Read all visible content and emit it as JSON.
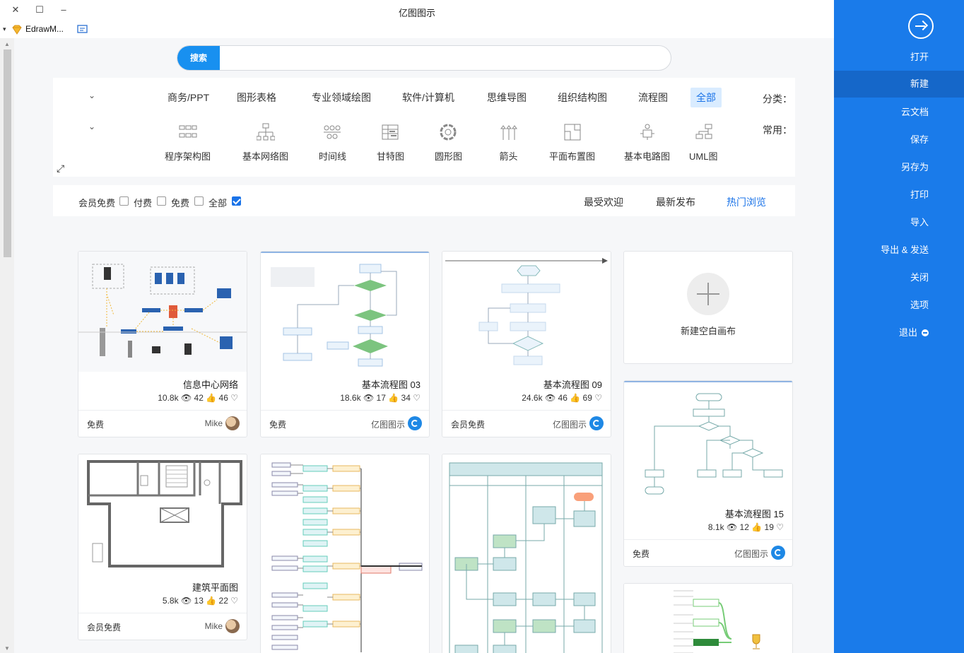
{
  "window": {
    "title": "亿图图示",
    "close": "✕",
    "maximize": "☐",
    "minimize": "–",
    "app_name": "EdrawM...",
    "dropdown": "▾"
  },
  "search": {
    "button": "搜索",
    "placeholder": ""
  },
  "categories": {
    "label": "分类：",
    "items": [
      "全部",
      "流程图",
      "组织结构图",
      "思维导图",
      "软件/计算机",
      "专业领域绘图",
      "图形表格",
      "商务/PPT"
    ],
    "active_index": 0,
    "expand": "⌄"
  },
  "common": {
    "label": "常用：",
    "items": [
      "UML图",
      "基本电路图",
      "平面布置图",
      "箭头",
      "圆形图",
      "甘特图",
      "时间线",
      "基本网络图",
      "程序架构图"
    ],
    "expand": "⌄"
  },
  "expand_icon": "⤢",
  "filter": {
    "tabs": [
      "热门浏览",
      "最新发布",
      "最受欢迎"
    ],
    "active_tab": 0,
    "checks": [
      {
        "label": "全部",
        "checked": true
      },
      {
        "label": "免费",
        "checked": false
      },
      {
        "label": "付费",
        "checked": false
      },
      {
        "label": "会员免费",
        "checked": false
      }
    ]
  },
  "new_blank": {
    "label": "新建空白画布"
  },
  "cards": [
    {
      "title": "基本流程图 09",
      "views": "24.6k",
      "likes": "46",
      "favs": "69",
      "author": "亿图图示",
      "price": "会员免费"
    },
    {
      "title": "基本流程图 03",
      "views": "18.6k",
      "likes": "17",
      "favs": "34",
      "author": "亿图图示",
      "price": "免费"
    },
    {
      "title": "信息中心网络",
      "views": "10.8k",
      "likes": "42",
      "favs": "46",
      "author": "Mike",
      "price": "免费"
    },
    {
      "title": "基本流程图 15",
      "views": "8.1k",
      "likes": "12",
      "favs": "19",
      "author": "亿图图示",
      "price": "免费"
    },
    {
      "title": "建筑平面图",
      "views": "5.8k",
      "likes": "13",
      "favs": "22",
      "author": "Mike",
      "price": "会员免费"
    }
  ],
  "sidebar": {
    "items": [
      "打开",
      "新建",
      "云文档",
      "保存",
      "另存为",
      "打印",
      "导入",
      "导出 & 发送",
      "关闭",
      "选项",
      "退出"
    ],
    "active_index": 1
  }
}
